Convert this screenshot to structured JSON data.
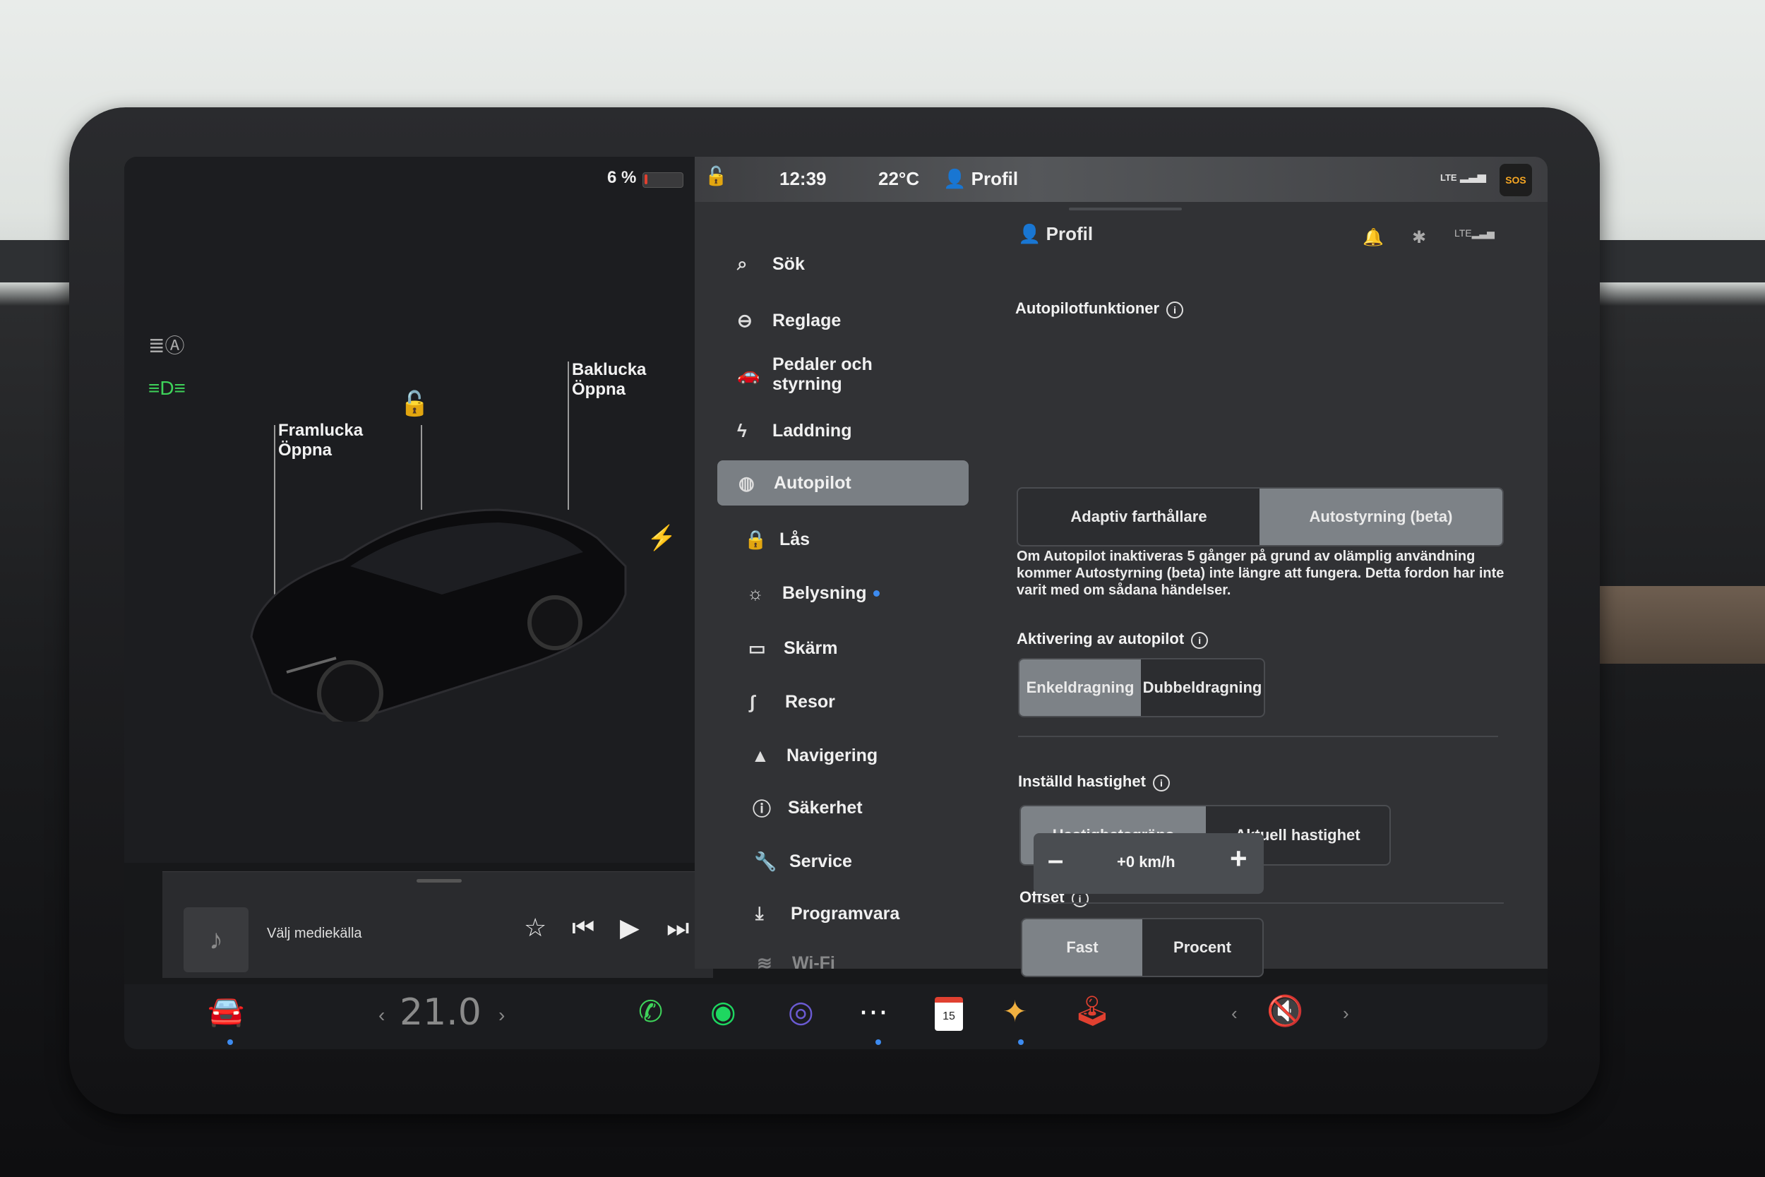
{
  "car_panel": {
    "battery": "6 %",
    "battery_level": 0.06,
    "frunk_title": "Framlucka",
    "frunk_state": "Öppna",
    "trunk_title": "Baklucka",
    "trunk_state": "Öppna",
    "lock_icon": "unlock-icon",
    "charge_icon": "bolt-icon"
  },
  "media": {
    "source_label": "Välj mediekälla"
  },
  "status_bar": {
    "time": "12:39",
    "temperature": "22°C",
    "profile": "Profil",
    "signal": "LTE",
    "sos": "SOS"
  },
  "menu": {
    "search": "Sök",
    "items": [
      {
        "label": "Reglage",
        "icon": "toggle-icon"
      },
      {
        "label": "Pedaler och styrning",
        "icon": "car-icon"
      },
      {
        "label": "Laddning",
        "icon": "bolt-icon"
      },
      {
        "label": "Autopilot",
        "icon": "steering-wheel-icon",
        "active": true
      },
      {
        "label": "Lås",
        "icon": "lock-icon"
      },
      {
        "label": "Belysning",
        "icon": "sun-icon"
      },
      {
        "label": "Skärm",
        "icon": "display-icon"
      },
      {
        "label": "Resor",
        "icon": "trips-icon"
      },
      {
        "label": "Navigering",
        "icon": "navigation-icon"
      },
      {
        "label": "Säkerhet",
        "icon": "alert-icon"
      },
      {
        "label": "Service",
        "icon": "wrench-icon"
      },
      {
        "label": "Programvara",
        "icon": "download-icon"
      },
      {
        "label": "Wi-Fi",
        "icon": "wifi-icon"
      }
    ]
  },
  "content": {
    "title": "Profil",
    "autopilot_features": {
      "heading": "Autopilotfunktioner",
      "option_a": "Adaptiv farthållare",
      "option_b": "Autostyrning (beta)",
      "selected": "Autostyrning (beta)",
      "note": "Om Autopilot inaktiveras 5 gånger på grund av olämplig användning kommer Autostyrning (beta) inte längre att fungera. Detta fordon har inte varit med om sådana händelser."
    },
    "activation": {
      "heading": "Aktivering av autopilot",
      "option_a": "Enkeldragning",
      "option_b": "Dubbeldragning",
      "selected": "Enkeldragning"
    },
    "set_speed": {
      "heading": "Inställd hastighet",
      "option_a": "Hastighetsgräns",
      "option_b": "Aktuell hastighet",
      "selected": "Hastighetsgräns"
    },
    "offset": {
      "heading": "Offset",
      "option_a": "Fast",
      "option_b": "Procent",
      "selected": "Fast",
      "value": "+0 km/h",
      "minus": "–",
      "plus": "+"
    }
  },
  "dock": {
    "cabin_temp": "21.0",
    "app_icons": [
      "car-icon",
      "phone-icon",
      "spotify-icon",
      "camera-icon",
      "more-icon",
      "calendar-icon",
      "toybox-icon",
      "joystick-icon",
      "volume-mute-icon"
    ],
    "calendar_day": "15"
  },
  "colors": {
    "accent_blue": "#3d8bf0",
    "selected_segment": "#7d8287",
    "panel_bg": "#313235",
    "battery_red": "#e04030",
    "lamp_green": "#3ed35a"
  }
}
